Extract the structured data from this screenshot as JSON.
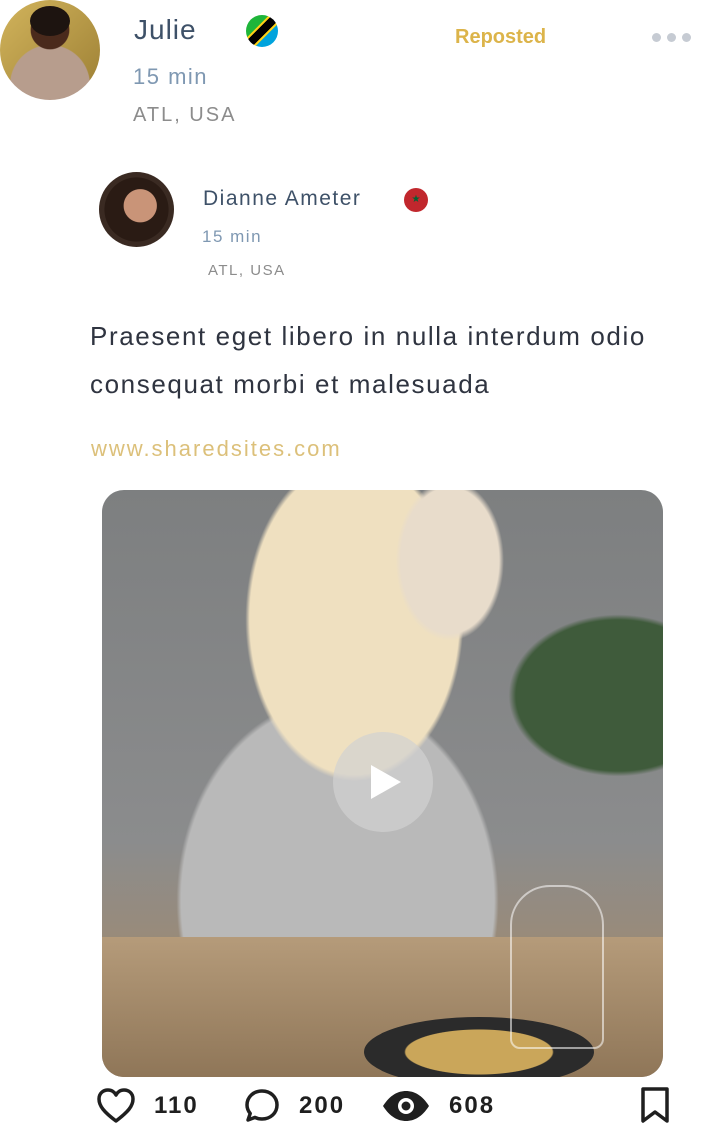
{
  "header": {
    "name": "Julie",
    "flag_icon": "tanzania-flag-icon",
    "repost_label": "Reposted",
    "time": "15 min",
    "location": "ATL, USA",
    "more_icon": "more-dots-icon"
  },
  "original_post": {
    "author": "Dianne Ameter",
    "flag_icon": "morocco-flag-icon",
    "time": "15 min",
    "location": "ATL, USA",
    "text": "Praesent eget libero in nulla interdum odio consequat morbi et malesuada",
    "link": "www.sharedsites.com",
    "media": {
      "type": "video",
      "play_icon": "play-icon"
    }
  },
  "stats": {
    "likes": "110",
    "comments": "200",
    "views": "608",
    "like_icon": "heart-icon",
    "comment_icon": "comment-icon",
    "views_icon": "eye-icon",
    "bookmark_icon": "bookmark-icon"
  },
  "colors": {
    "accent_gold": "#dcb44a",
    "link_gold": "#dcc07a",
    "name_blue": "#3e5168",
    "time_blue": "#7f98b2"
  }
}
